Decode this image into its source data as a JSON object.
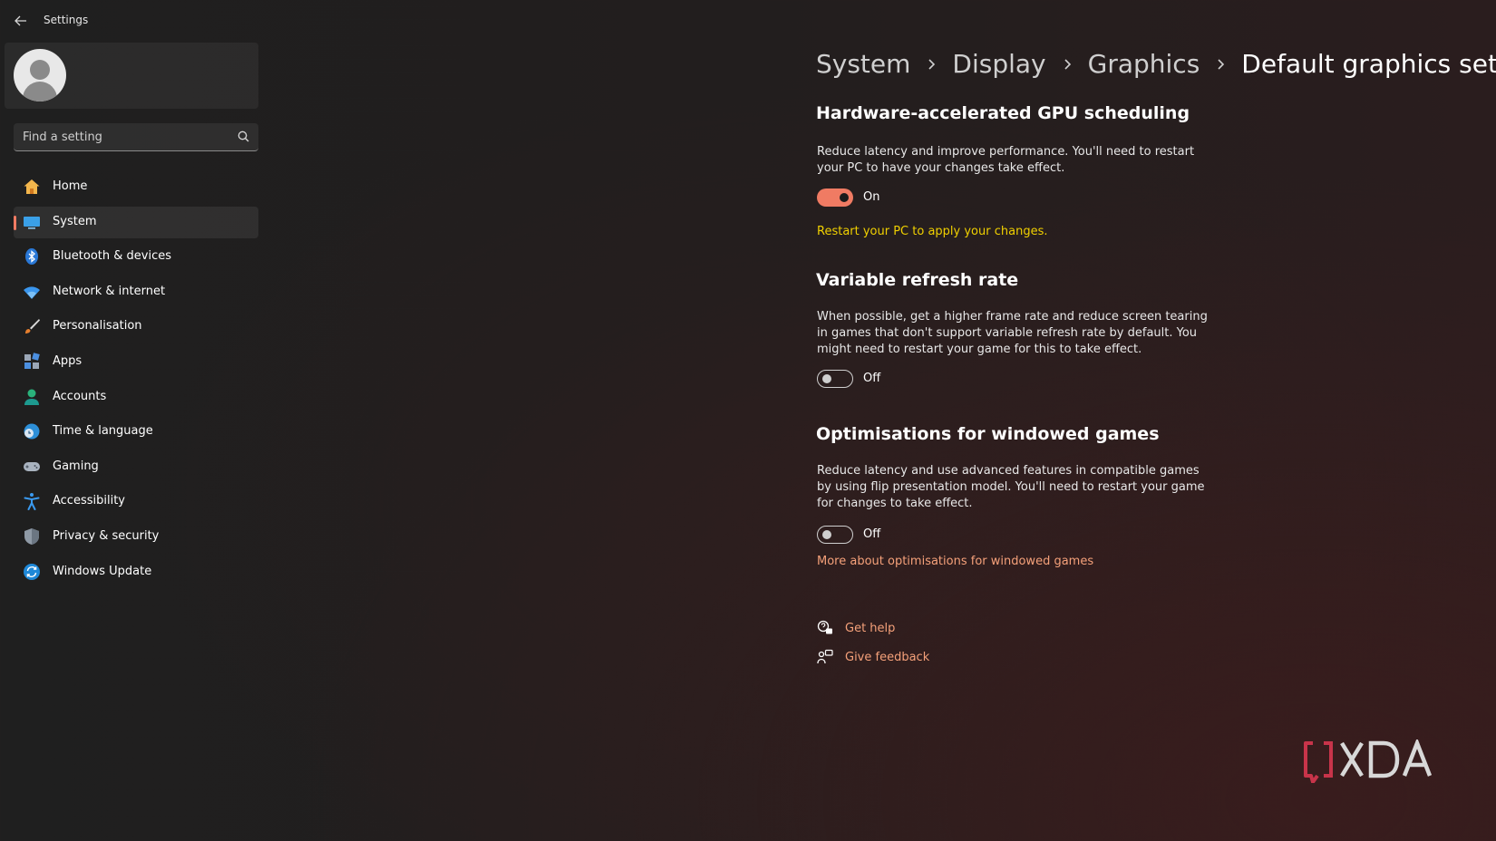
{
  "titlebar": {
    "app_title": "Settings"
  },
  "search": {
    "placeholder": "Find a setting"
  },
  "sidebar": {
    "items": [
      {
        "label": "Home"
      },
      {
        "label": "System"
      },
      {
        "label": "Bluetooth & devices"
      },
      {
        "label": "Network & internet"
      },
      {
        "label": "Personalisation"
      },
      {
        "label": "Apps"
      },
      {
        "label": "Accounts"
      },
      {
        "label": "Time & language"
      },
      {
        "label": "Gaming"
      },
      {
        "label": "Accessibility"
      },
      {
        "label": "Privacy & security"
      },
      {
        "label": "Windows Update"
      }
    ],
    "selected": "System"
  },
  "breadcrumb": {
    "system": "System",
    "display": "Display",
    "graphics": "Graphics",
    "current": "Default graphics settings"
  },
  "gpu_scheduling": {
    "title": "Hardware-accelerated GPU scheduling",
    "description": "Reduce latency and improve performance. You'll need to restart your PC to have your changes take effect.",
    "state": "On",
    "warning": "Restart your PC to apply your changes."
  },
  "vrr": {
    "title": "Variable refresh rate",
    "description": "When possible, get a higher frame rate and reduce screen tearing in games that don't support variable refresh rate by default. You might need to restart your game for this to take effect.",
    "state": "Off"
  },
  "windowed": {
    "title": "Optimisations for windowed games",
    "description": "Reduce latency and use advanced features in compatible games by using flip presentation model. You'll need to restart your game for changes to take effect.",
    "state": "Off",
    "more_link": "More about optimisations for windowed games"
  },
  "help": {
    "get_help": "Get help",
    "give_feedback": "Give feedback"
  },
  "colors": {
    "accent": "#f07b63",
    "link": "#f5a17a",
    "warning": "#f0d000"
  },
  "watermark": {
    "text": "XDA"
  }
}
